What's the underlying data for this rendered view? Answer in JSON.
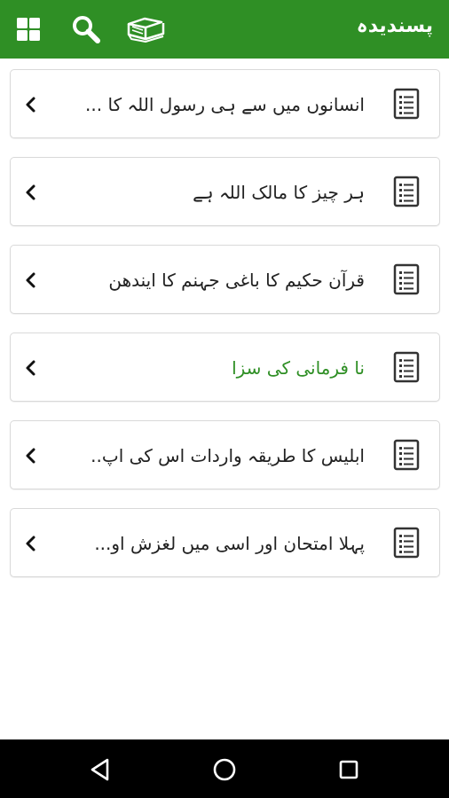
{
  "header": {
    "title": "پسندیدہ",
    "icons": [
      "grid-icon",
      "search-icon",
      "book-icon"
    ]
  },
  "items": [
    {
      "label": "انسانوں میں سے ہی رسول اللہ کا ..."
    },
    {
      "label": "ہر چیز کا مالک اللہ ہے"
    },
    {
      "label": "قرآن حکیم کا باغی جہنم کا ایندھن"
    },
    {
      "label": "نا فرمانی کی سزا"
    },
    {
      "label": "ابلیس کا طریقہ واردات اس کی اپ.."
    },
    {
      "label": "پہلا امتحان اور اسی میں لغزش او..."
    }
  ],
  "navbar": {
    "buttons": [
      "back-icon",
      "home-icon",
      "recents-icon"
    ]
  },
  "colors": {
    "primary": "#2f8f25",
    "accent_text": "#2f8f25",
    "nav_background": "#000000"
  }
}
